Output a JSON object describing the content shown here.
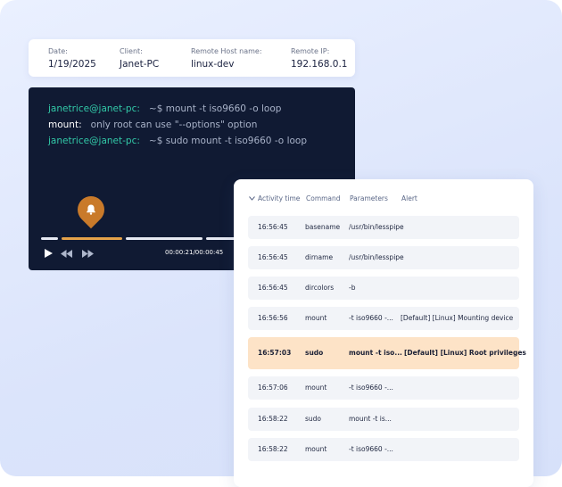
{
  "info": {
    "date_label": "Date:",
    "date_value": "1/19/2025",
    "client_label": "Client:",
    "client_value": "Janet-PC",
    "host_label": "Remote Host name:",
    "host_value": "linux-dev",
    "ip_label": "Remote IP:",
    "ip_value": "192.168.0.1"
  },
  "terminal": {
    "line1_prompt": "janetrice@janet-pc:",
    "line1_cmd": "~$ mount -t iso9660 -o loop",
    "line2_prefix": "mount:",
    "line2_msg": "only root can use \"--options\" option",
    "line3_prompt": "janetrice@janet-pc:",
    "line3_cmd": "~$ sudo mount -t iso9660 -o loop",
    "time_readout": "00:00:21/00:00:45",
    "progress": 0.47,
    "icons": [
      "bell-icon",
      "play-icon",
      "rewind-icon",
      "fast-forward-icon"
    ]
  },
  "table": {
    "headers": {
      "time": "Activity time",
      "command": "Command",
      "parameters": "Parameters",
      "alert": "Alert"
    },
    "rows": [
      {
        "time": "16:56:45",
        "command": "basename",
        "parameters": "/usr/bin/lesspipe",
        "alert": ""
      },
      {
        "time": "16:56:45",
        "command": "dirname",
        "parameters": "/usr/bin/lesspipe",
        "alert": ""
      },
      {
        "time": "16:56:45",
        "command": "dircolors",
        "parameters": "-b",
        "alert": ""
      },
      {
        "time": "16:56:56",
        "command": "mount",
        "parameters": "-t iso9660 -...",
        "alert": "[Default] [Linux] Mounting device"
      },
      {
        "time": "16:57:03",
        "command": "sudo",
        "parameters": "mount -t iso...",
        "alert": "[Default] [Linux] Root privileges",
        "highlighted": true
      },
      {
        "time": "16:57:06",
        "command": "mount",
        "parameters": "-t iso9660 -...",
        "alert": ""
      },
      {
        "time": "16:58:22",
        "command": "sudo",
        "parameters": "mount -t is...",
        "alert": ""
      },
      {
        "time": "16:58:22",
        "command": "mount",
        "parameters": "-t iso9660 -...",
        "alert": ""
      }
    ]
  },
  "colors": {
    "terminal_bg": "#101a33",
    "prompt": "#32c9a8",
    "accent": "#e5a24a",
    "highlight_row": "#fde3c7"
  }
}
